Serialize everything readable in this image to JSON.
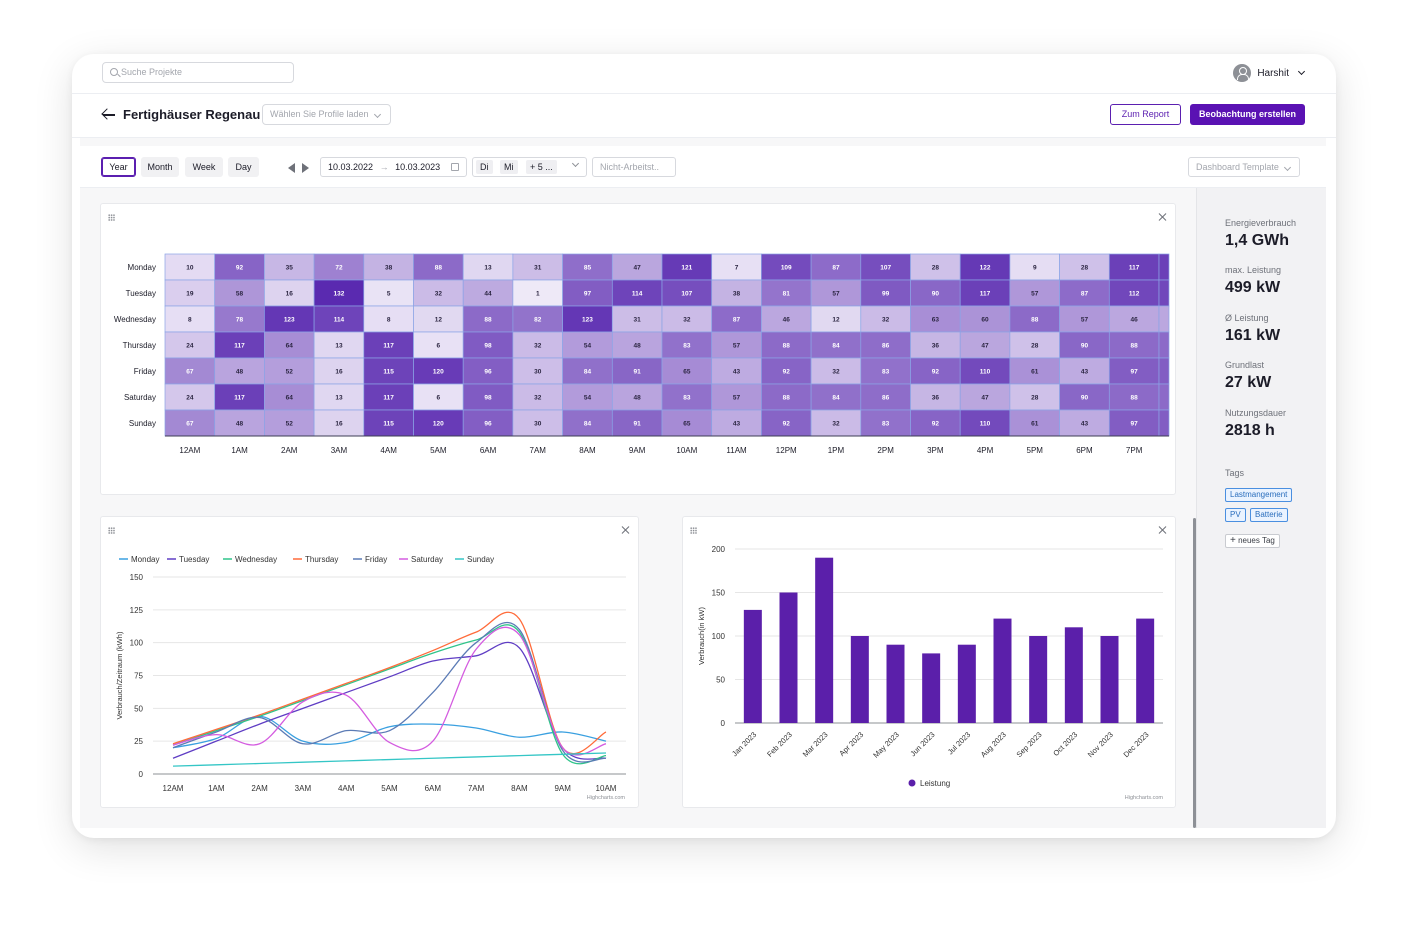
{
  "topbar": {
    "search_placeholder": "Suche Projekte",
    "user_name": "Harshit"
  },
  "header": {
    "title": "Fertighäuser Regenau",
    "profile_placeholder": "Wählen Sie Profile laden",
    "report_label": "Zum Report",
    "observe_label": "Beobachtung erstellen"
  },
  "filters": {
    "periods": [
      "Year",
      "Month",
      "Week",
      "Day"
    ],
    "active_period": "Year",
    "date_from": "10.03.2022",
    "date_sep": "→",
    "date_to": "10.03.2023",
    "day_chips": [
      "Di",
      "Mi",
      "+ 5 ..."
    ],
    "nonwork_placeholder": "Nicht-Arbeitst..",
    "template_placeholder": "Dashboard Template"
  },
  "kpis": [
    {
      "label": "Energieverbrauch",
      "value": "1,4 GWh"
    },
    {
      "label": "max. Leistung",
      "value": "499 kW"
    },
    {
      "label": "Ø Leistung",
      "value": "161 kW"
    },
    {
      "label": "Grundlast",
      "value": "27 kW"
    },
    {
      "label": "Nutzungsdauer",
      "value": "2818 h"
    }
  ],
  "tags": {
    "title": "Tags",
    "items": [
      "Lastmangement",
      "PV",
      "Batterie"
    ],
    "new_label": "neues Tag"
  },
  "chart_data": [
    {
      "type": "heatmap",
      "rows": [
        "Monday",
        "Tuesday",
        "Wednesday",
        "Thursday",
        "Friday",
        "Saturday",
        "Sunday"
      ],
      "columns": [
        "12AM",
        "1AM",
        "2AM",
        "3AM",
        "4AM",
        "5AM",
        "6AM",
        "7AM",
        "8AM",
        "9AM",
        "10AM",
        "11AM",
        "12PM",
        "1PM",
        "2PM",
        "3PM",
        "4PM",
        "5PM",
        "6PM",
        "7PM"
      ],
      "values": [
        [
          10,
          92,
          35,
          72,
          38,
          88,
          13,
          31,
          85,
          47,
          121,
          7,
          109,
          87,
          107,
          28,
          122,
          9,
          28,
          117
        ],
        [
          19,
          58,
          16,
          132,
          5,
          32,
          44,
          1,
          97,
          114,
          107,
          38,
          81,
          57,
          99,
          90,
          117,
          57,
          87,
          112
        ],
        [
          8,
          78,
          123,
          114,
          8,
          12,
          88,
          82,
          123,
          31,
          32,
          87,
          46,
          12,
          32,
          63,
          60,
          88,
          57,
          46
        ],
        [
          24,
          117,
          64,
          13,
          117,
          6,
          98,
          32,
          54,
          48,
          83,
          57,
          88,
          84,
          86,
          36,
          47,
          28,
          90,
          88
        ],
        [
          67,
          48,
          52,
          16,
          115,
          120,
          96,
          30,
          84,
          91,
          65,
          43,
          92,
          32,
          83,
          92,
          110,
          61,
          43,
          97
        ],
        [
          24,
          117,
          64,
          13,
          117,
          6,
          98,
          32,
          54,
          48,
          83,
          57,
          88,
          84,
          86,
          36,
          47,
          28,
          90,
          88
        ],
        [
          67,
          48,
          52,
          16,
          115,
          120,
          96,
          30,
          84,
          91,
          65,
          43,
          92,
          32,
          83,
          92,
          110,
          61,
          43,
          97
        ]
      ],
      "color_low": "#efeaf8",
      "color_high": "#5a2ab0"
    },
    {
      "type": "line",
      "x": [
        "12AM",
        "1AM",
        "2AM",
        "3AM",
        "4AM",
        "5AM",
        "6AM",
        "7AM",
        "8AM",
        "9AM",
        "10AM"
      ],
      "ylabel": "Verbrauch/Zeitraum (kWh)",
      "ylim": [
        0,
        150
      ],
      "yticks": [
        0,
        25,
        50,
        75,
        100,
        125,
        150
      ],
      "legend_position": "top",
      "series": [
        {
          "name": "Monday",
          "color": "#3aa0e0",
          "values": [
            20,
            27,
            44,
            25,
            24,
            36,
            38,
            35,
            28,
            32,
            25
          ]
        },
        {
          "name": "Tuesday",
          "color": "#5f3dc4",
          "values": [
            12,
            25,
            38,
            50,
            62,
            74,
            86,
            90,
            96,
            20,
            12
          ]
        },
        {
          "name": "Wednesday",
          "color": "#2fc48a",
          "values": [
            22,
            33,
            44,
            56,
            68,
            80,
            92,
            102,
            108,
            15,
            14
          ]
        },
        {
          "name": "Thursday",
          "color": "#ff6b3a",
          "values": [
            23,
            34,
            45,
            57,
            69,
            81,
            94,
            108,
            118,
            20,
            32
          ]
        },
        {
          "name": "Friday",
          "color": "#5b7bb5",
          "values": [
            20,
            32,
            43,
            23,
            33,
            33,
            62,
            100,
            110,
            18,
            12
          ]
        },
        {
          "name": "Saturday",
          "color": "#d45ce0",
          "values": [
            22,
            30,
            23,
            55,
            60,
            24,
            25,
            95,
            106,
            20,
            23
          ]
        },
        {
          "name": "Sunday",
          "color": "#35c6c6",
          "values": [
            6,
            7,
            8,
            9,
            10,
            11,
            12,
            13,
            14,
            15,
            16
          ]
        }
      ],
      "credit": "Highcharts.com"
    },
    {
      "type": "bar",
      "categories": [
        "Jan 2023",
        "Feb 2023",
        "Mar 2023",
        "Apr 2023",
        "May 2023",
        "Jun 2023",
        "Jul 2023",
        "Aug 2023",
        "Sep 2023",
        "Oct 2023",
        "Nov 2023",
        "Dec 2023"
      ],
      "series": [
        {
          "name": "Leistung",
          "color": "#5b1faa",
          "values": [
            130,
            150,
            190,
            100,
            90,
            80,
            90,
            120,
            100,
            110,
            100,
            120
          ]
        }
      ],
      "ylabel": "Verbrauch(in kW)",
      "ylim": [
        0,
        200
      ],
      "yticks": [
        0,
        50,
        100,
        150,
        200
      ],
      "legend_position": "bottom",
      "credit": "Highcharts.com"
    }
  ]
}
